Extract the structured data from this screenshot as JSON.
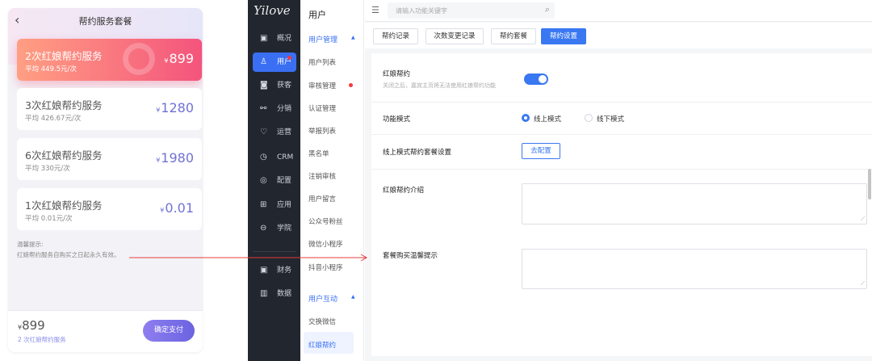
{
  "phone": {
    "title": "帮约服务套餐",
    "back_icon": "‹",
    "packages": [
      {
        "name": "2次红娘帮约服务",
        "avg": "平均 449.5元/次",
        "price_symbol": "¥",
        "price": "899",
        "selected": true
      },
      {
        "name": "3次红娘帮约服务",
        "avg": "平均 426.67元/次",
        "price_symbol": "¥",
        "price": "1280",
        "selected": false
      },
      {
        "name": "6次红娘帮约服务",
        "avg": "平均 330元/次",
        "price_symbol": "¥",
        "price": "1980",
        "selected": false
      },
      {
        "name": "1次红娘帮约服务",
        "avg": "平均 0.01元/次",
        "price_symbol": "¥",
        "price": "0.01",
        "selected": false
      }
    ],
    "tip_title": "温馨提示:",
    "tip_text": "红娘帮约服务自购买之日起永久有效。",
    "total_symbol": "¥",
    "total": "899",
    "total_desc": "2 次红娘帮约服务",
    "pay_button": "确定支付"
  },
  "sidebar": {
    "logo": "Yilove",
    "items": [
      {
        "icon": "▣",
        "icon_name": "overview-icon",
        "label": "概况"
      },
      {
        "icon": "♙",
        "icon_name": "user-icon",
        "label": "用户",
        "active": true
      },
      {
        "icon": "◙",
        "icon_name": "acquire-icon",
        "label": "获客"
      },
      {
        "icon": "⚯",
        "icon_name": "distribution-icon",
        "label": "分销"
      },
      {
        "icon": "♡",
        "icon_name": "operation-icon",
        "label": "运营"
      },
      {
        "icon": "◷",
        "icon_name": "crm-icon",
        "label": "CRM"
      },
      {
        "icon": "◎",
        "icon_name": "config-icon",
        "label": "配置"
      },
      {
        "icon": "⊞",
        "icon_name": "apps-icon",
        "label": "应用"
      },
      {
        "icon": "⊖",
        "icon_name": "school-icon",
        "label": "学院"
      },
      {
        "icon": "▣",
        "icon_name": "finance-icon",
        "label": "财务"
      },
      {
        "icon": "▥",
        "icon_name": "data-icon",
        "label": "数据"
      }
    ]
  },
  "submenu": {
    "title": "用户",
    "group1": "用户管理",
    "group1_items": [
      "用户列表",
      "审核管理",
      "认证管理",
      "举报列表",
      "黑名单",
      "注销审核",
      "用户留言",
      "公众号粉丝",
      "微信小程序",
      "抖音小程序"
    ],
    "group2": "用户互动",
    "group2_items": [
      "交换微信",
      "红娘帮约"
    ]
  },
  "topbar": {
    "menu_icon": "☰",
    "search_placeholder": "请输入功能关键字",
    "search_icon": "⌕"
  },
  "tabs": [
    "帮约记录",
    "次数变更记录",
    "帮约套餐",
    "帮约设置"
  ],
  "settings": {
    "hongniang_label": "红娘帮约",
    "hongniang_desc": "关闭之后，嘉宾主页将无法使用红娘帮约功能",
    "toggle_on": true,
    "mode_label": "功能模式",
    "mode_online": "线上模式",
    "mode_offline": "线下模式",
    "package_label": "线上模式帮约套餐设置",
    "config_button": "去配置",
    "intro_label": "红娘帮约介绍",
    "tip_label": "套餐购买温馨提示",
    "resize_icon": "⟋"
  }
}
